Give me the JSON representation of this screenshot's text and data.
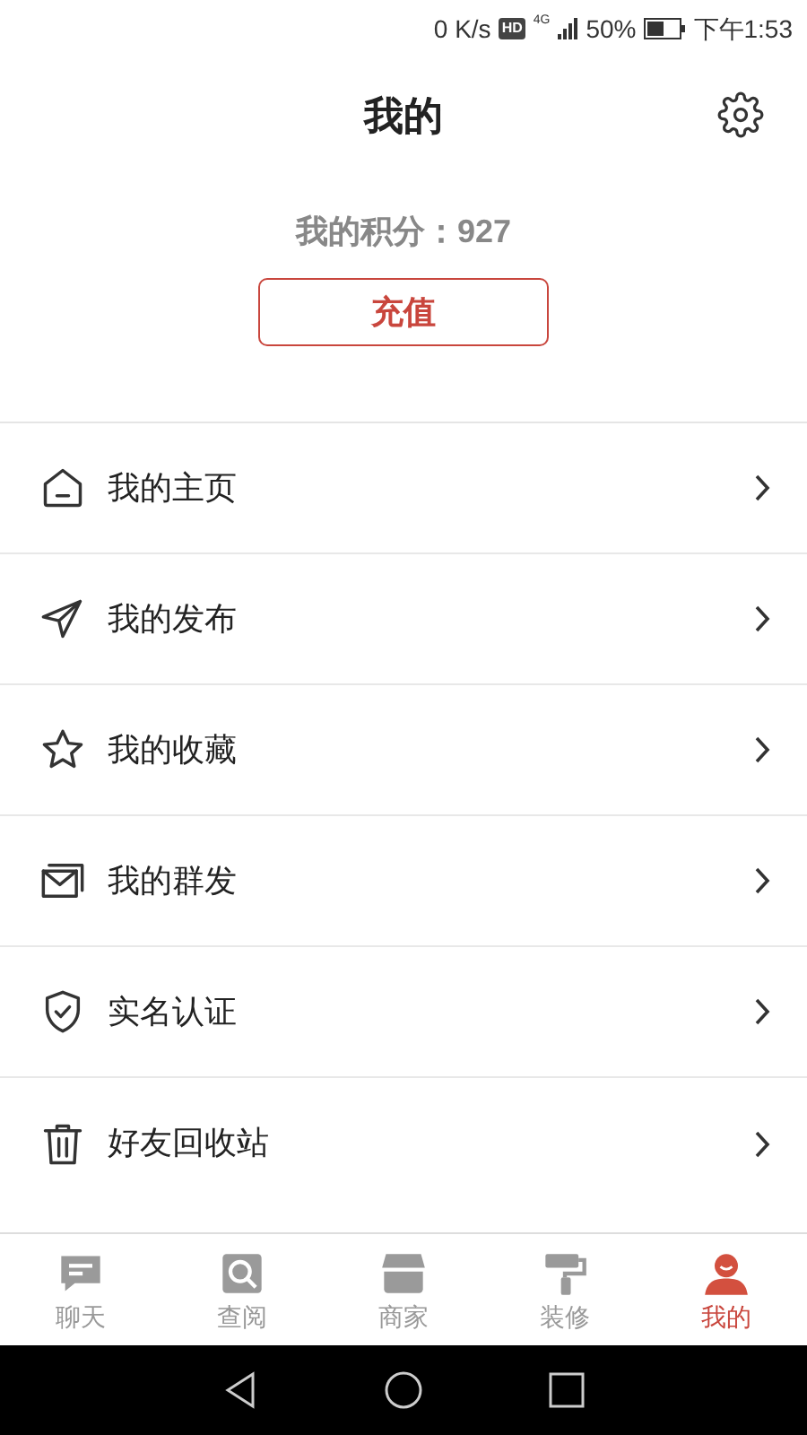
{
  "status_bar": {
    "speed": "0 K/s",
    "hd": "HD",
    "network": "4G",
    "battery": "50%",
    "time": "下午1:53"
  },
  "header": {
    "title": "我的"
  },
  "points": {
    "label": "我的积分：927"
  },
  "recharge_button": "充值",
  "menu": [
    {
      "label": "我的主页"
    },
    {
      "label": "我的发布"
    },
    {
      "label": "我的收藏"
    },
    {
      "label": "我的群发"
    },
    {
      "label": "实名认证"
    },
    {
      "label": "好友回收站"
    }
  ],
  "tabs": [
    {
      "label": "聊天",
      "selected": false
    },
    {
      "label": "查阅",
      "selected": false
    },
    {
      "label": "商家",
      "selected": false
    },
    {
      "label": "装修",
      "selected": false
    },
    {
      "label": "我的",
      "selected": true
    }
  ]
}
